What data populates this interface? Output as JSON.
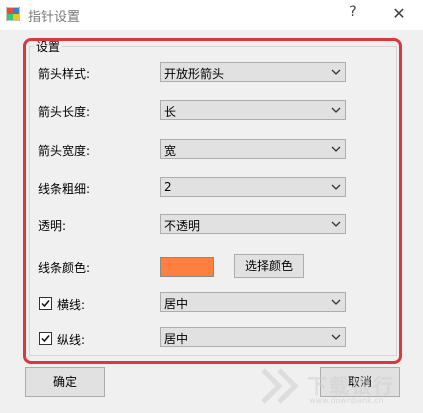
{
  "window": {
    "title": "指针设置",
    "help_glyph": "?",
    "close_glyph": "✕"
  },
  "group": {
    "title": "设置"
  },
  "fields": {
    "arrow_style": {
      "label": "箭头样式:",
      "value": "开放形箭头"
    },
    "arrow_length": {
      "label": "箭头长度:",
      "value": "长"
    },
    "arrow_width": {
      "label": "箭头宽度:",
      "value": "宽"
    },
    "line_thickness": {
      "label": "线条粗细:",
      "value": "2"
    },
    "transparency": {
      "label": "透明:",
      "value": "不透明"
    },
    "line_color": {
      "label": "线条颜色:",
      "color": "#ff7f3f",
      "button": "选择颜色"
    },
    "horizontal_line": {
      "label": "横线:",
      "checked": true,
      "value": "居中"
    },
    "vertical_line": {
      "label": "纵线:",
      "checked": true,
      "value": "居中"
    }
  },
  "buttons": {
    "ok": "确定",
    "cancel": "取消"
  },
  "watermark": {
    "text": "下载银行",
    "url": "www.downbank.cn"
  },
  "colors": {
    "highlight": "#d9393e"
  }
}
